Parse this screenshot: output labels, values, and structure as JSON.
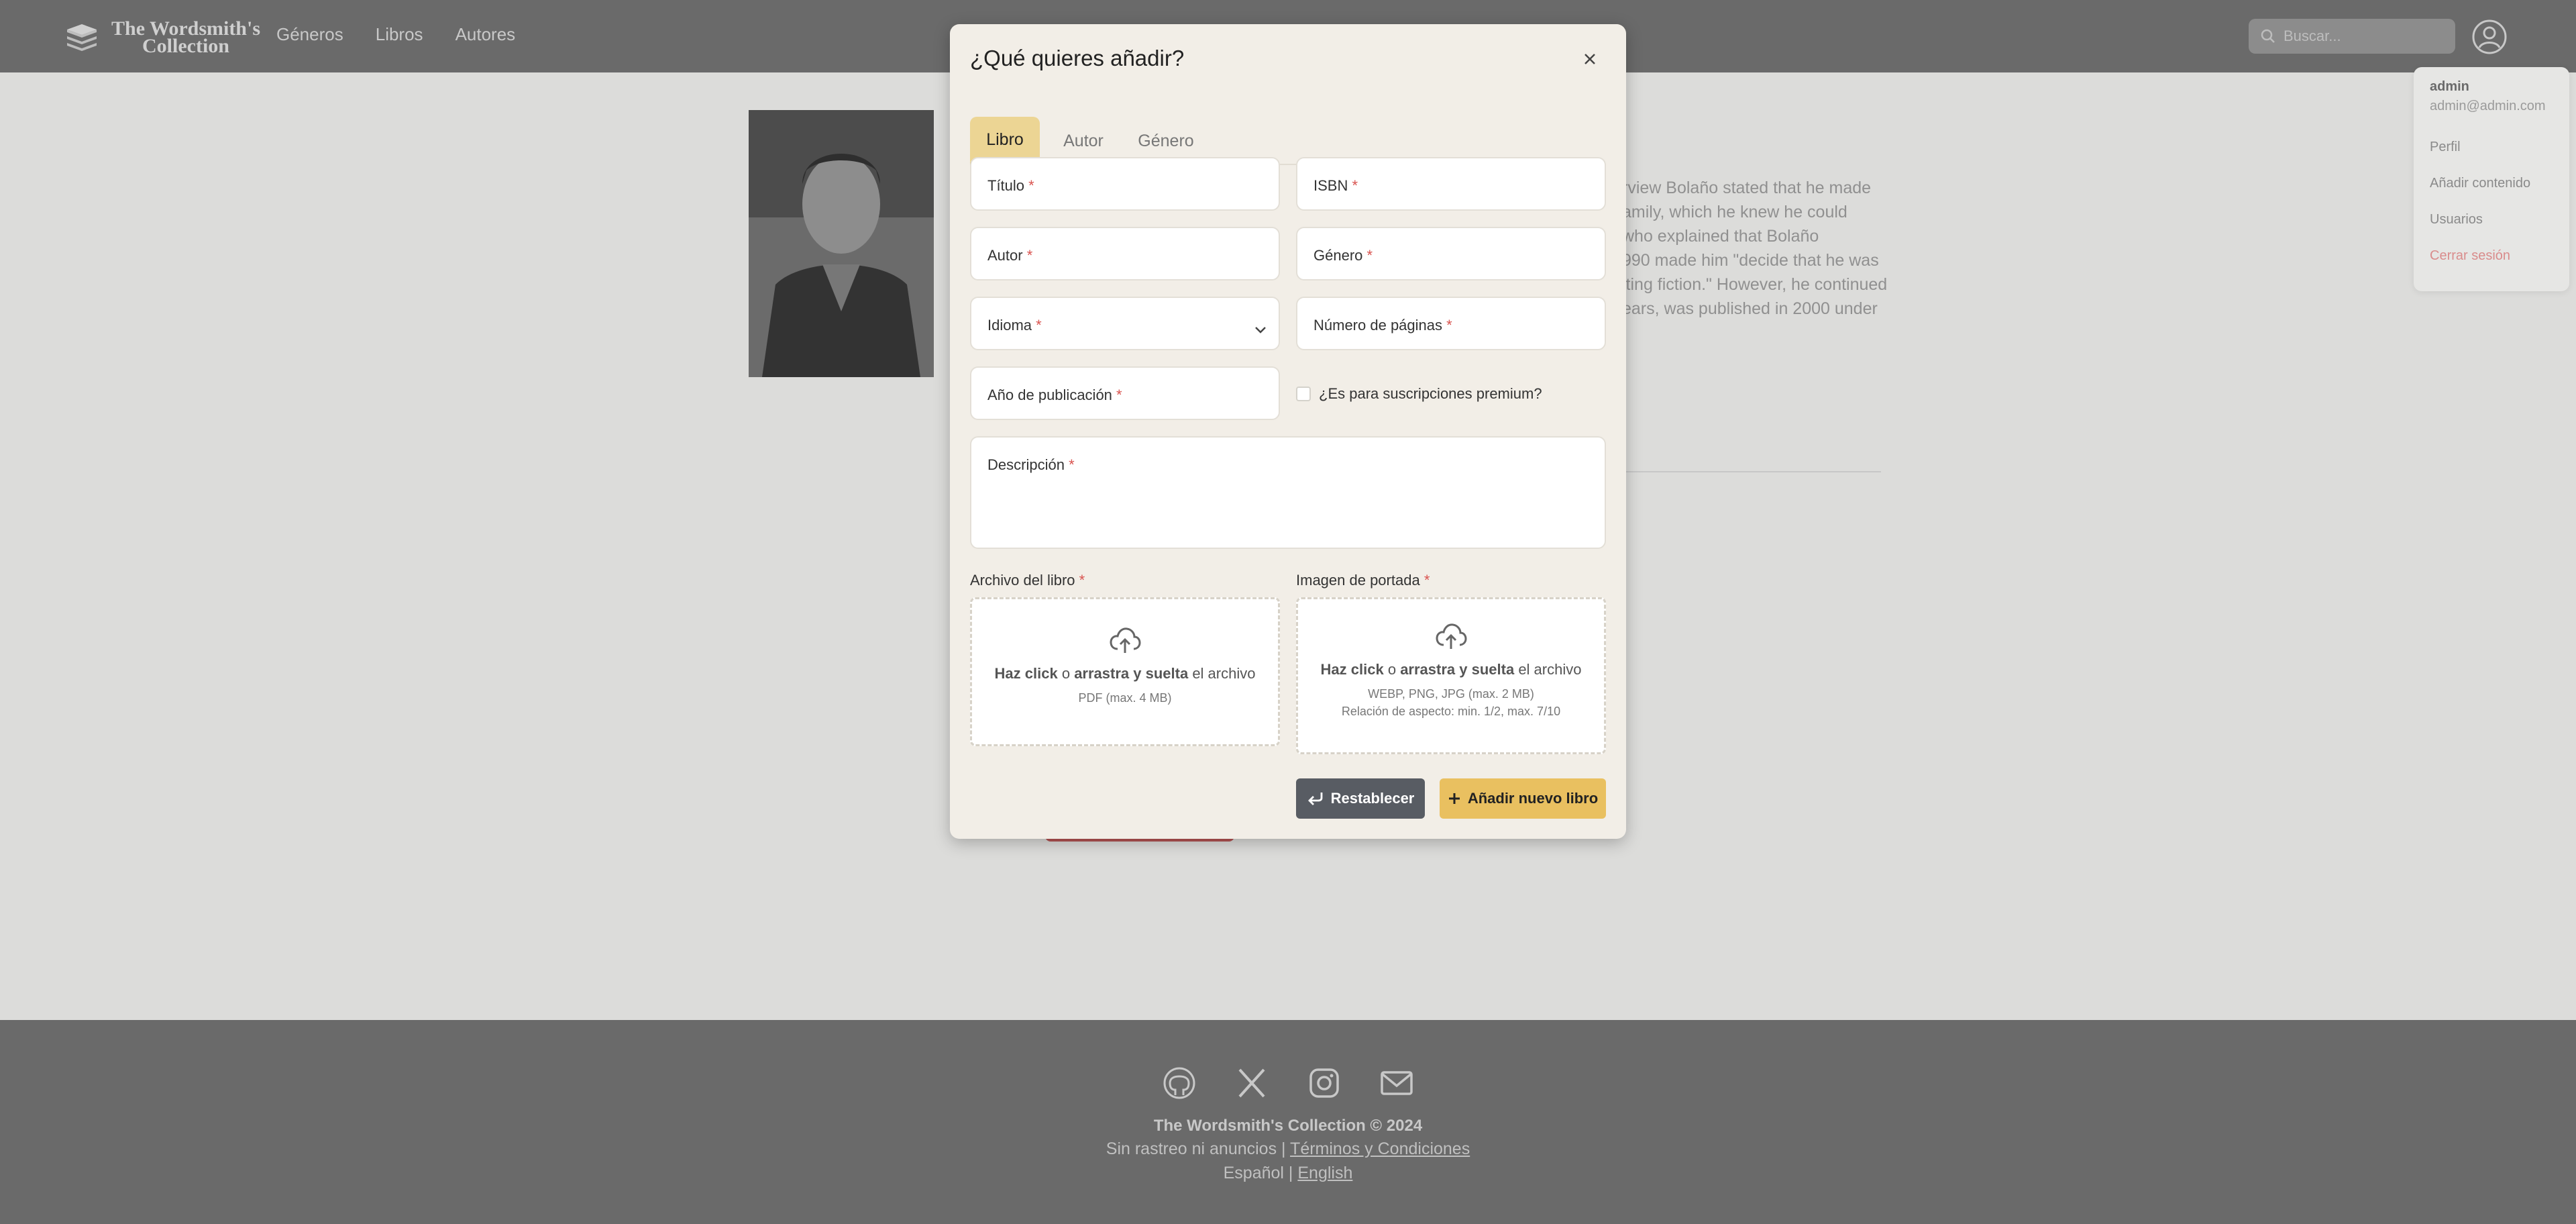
{
  "app": {
    "logo_line1": "The Wordsmith's",
    "logo_line2": "Collection"
  },
  "nav": {
    "links": [
      "Géneros",
      "Libros",
      "Autores"
    ],
    "search_placeholder": "Buscar..."
  },
  "background": {
    "bio_lines": [
      "rview Bolaño stated that he made",
      "amily, which he knew he could",
      "who explained that Bolaño",
      "990 made him \"decide that he was",
      "iting fiction.\" However, he continued",
      "ears, was published in 2000 under"
    ]
  },
  "user_menu": {
    "name": "admin",
    "email": "admin@admin.com",
    "items": [
      "Perfil",
      "Añadir contenido",
      "Usuarios",
      "Cerrar sesión"
    ]
  },
  "modal": {
    "title": "¿Qué quieres añadir?",
    "tabs": [
      "Libro",
      "Autor",
      "Género"
    ],
    "active_tab": "Libro",
    "fields": {
      "titulo": "Título",
      "isbn": "ISBN",
      "autor": "Autor",
      "genero": "Género",
      "idioma": "Idioma",
      "paginas": "Número de páginas",
      "anio": "Año de publicación",
      "descripcion": "Descripción",
      "required_mark": "*"
    },
    "premium_label": "¿Es para suscripciones premium?",
    "book_file": {
      "label": "Archivo del libro",
      "click": "Haz click",
      "or": "o",
      "drag": "arrastra y suelta",
      "the_file": "el archivo",
      "hint": "PDF (max. 4 MB)"
    },
    "cover_image": {
      "label": "Imagen de portada",
      "click": "Haz click",
      "or": "o",
      "drag": "arrastra y suelta",
      "the_file": "el archivo",
      "hint": "WEBP, PNG, JPG (max. 2 MB)",
      "hint2": "Relación de aspecto: min. 1/2, max. 7/10"
    },
    "reset_label": "Restablecer",
    "add_label": "Añadir nuevo libro"
  },
  "footer": {
    "copyright": "The Wordsmith's Collection © 2024",
    "tagline": "Sin rastreo ni anuncios",
    "separator": "|",
    "terms": "Términos y Condiciones",
    "lang_es": "Español",
    "lang_en": "English"
  },
  "colors": {
    "modal_bg": "#f2eee7",
    "tab_active": "#ecd594",
    "add_button": "#e9c060",
    "reset_button": "#585c63",
    "required": "#d9534f"
  }
}
